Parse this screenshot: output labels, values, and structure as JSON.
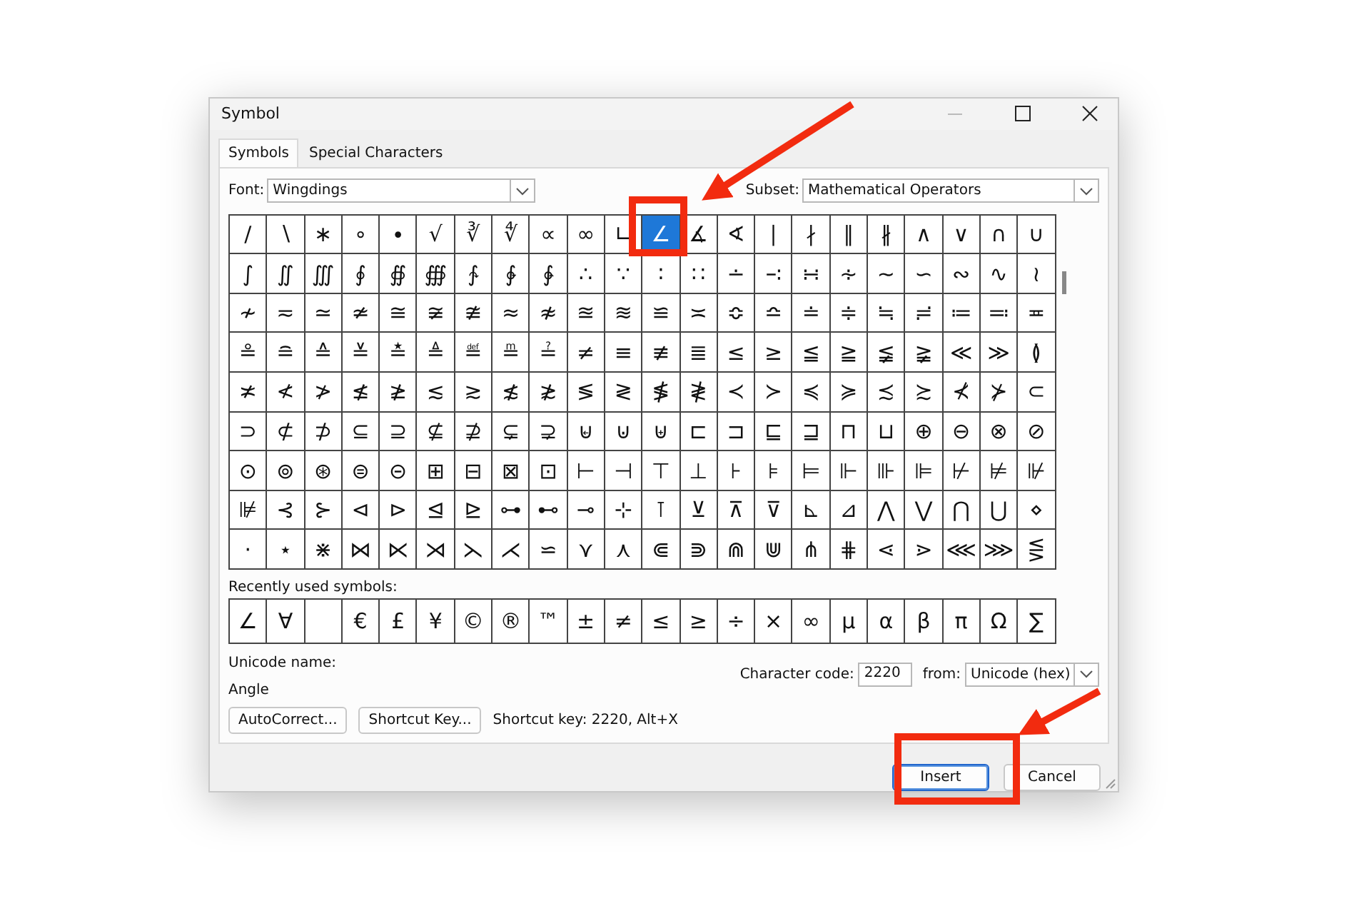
{
  "window": {
    "title": "Symbol"
  },
  "tabs": [
    {
      "label": "Symbols",
      "selected": true
    },
    {
      "label": "Special Characters",
      "selected": false
    }
  ],
  "font": {
    "label": "Font:",
    "value": "Wingdings"
  },
  "subset": {
    "label": "Subset:",
    "value": "Mathematical Operators"
  },
  "grid": [
    [
      {
        "s": "∕",
        "selected": false
      },
      {
        "s": "∖",
        "selected": false
      },
      {
        "s": "∗",
        "selected": false
      },
      {
        "s": "∘",
        "selected": false
      },
      {
        "s": "∙",
        "selected": false
      },
      {
        "s": "√",
        "selected": false
      },
      {
        "s": "∛",
        "selected": false
      },
      {
        "s": "∜",
        "selected": false
      },
      {
        "s": "∝",
        "selected": false
      },
      {
        "s": "∞",
        "selected": false
      },
      {
        "s": "∟",
        "selected": false
      },
      {
        "s": "∠",
        "selected": true
      },
      {
        "s": "∡",
        "selected": false
      },
      {
        "s": "∢",
        "selected": false
      },
      {
        "s": "∣",
        "selected": false
      },
      {
        "s": "∤",
        "selected": false
      },
      {
        "s": "∥",
        "selected": false
      },
      {
        "s": "∦",
        "selected": false
      },
      {
        "s": "∧",
        "selected": false
      },
      {
        "s": "∨",
        "selected": false
      },
      {
        "s": "∩",
        "selected": false
      },
      {
        "s": "∪",
        "selected": false
      }
    ],
    [
      "∫",
      "∬",
      "∭",
      "∮",
      "∯",
      "∰",
      "∱",
      "∲",
      "∳",
      "∴",
      "∵",
      "∶",
      "∷",
      "∸",
      "∹",
      "∺",
      "∻",
      "∼",
      "∽",
      "∾",
      "∿",
      "≀"
    ],
    [
      "≁",
      "≂",
      "≃",
      "≄",
      "≅",
      "≆",
      "≇",
      "≈",
      "≉",
      "≊",
      "≋",
      "≌",
      "≍",
      "≎",
      "≏",
      "≐",
      "≑",
      "≒",
      "≓",
      "≔",
      "≕",
      "≖"
    ],
    [
      "≗",
      "≘",
      "≙",
      "≚",
      "≛",
      "≜",
      "≝",
      "≞",
      "≟",
      "≠",
      "≡",
      "≢",
      "≣",
      "≤",
      "≥",
      "≦",
      "≧",
      "≨",
      "≩",
      "≪",
      "≫",
      "≬"
    ],
    [
      "≭",
      "≮",
      "≯",
      "≰",
      "≱",
      "≲",
      "≳",
      "≴",
      "≵",
      "≶",
      "≷",
      "≸",
      "≹",
      "≺",
      "≻",
      "≼",
      "≽",
      "≾",
      "≿",
      "⊀",
      "⊁",
      "⊂"
    ],
    [
      "⊃",
      "⊄",
      "⊅",
      "⊆",
      "⊇",
      "⊈",
      "⊉",
      "⊊",
      "⊋",
      "⊌",
      "⊍",
      "⊎",
      "⊏",
      "⊐",
      "⊑",
      "⊒",
      "⊓",
      "⊔",
      "⊕",
      "⊖",
      "⊗",
      "⊘"
    ],
    [
      "⊙",
      "⊚",
      "⊛",
      "⊜",
      "⊝",
      "⊞",
      "⊟",
      "⊠",
      "⊡",
      "⊢",
      "⊣",
      "⊤",
      "⊥",
      "⊦",
      "⊧",
      "⊨",
      "⊩",
      "⊪",
      "⊫",
      "⊬",
      "⊭",
      "⊮"
    ],
    [
      "⊯",
      "⊰",
      "⊱",
      "⊲",
      "⊳",
      "⊴",
      "⊵",
      "⊶",
      "⊷",
      "⊸",
      "⊹",
      "⊺",
      "⊻",
      "⊼",
      "⊽",
      "⊾",
      "⊿",
      "⋀",
      "⋁",
      "⋂",
      "⋃",
      "⋄"
    ],
    [
      "⋅",
      "⋆",
      "⋇",
      "⋈",
      "⋉",
      "⋊",
      "⋋",
      "⋌",
      "⋍",
      "⋎",
      "⋏",
      "⋐",
      "⋑",
      "⋒",
      "⋓",
      "⋔",
      "⋕",
      "⋖",
      "⋗",
      "⋘",
      "⋙",
      "⋚"
    ]
  ],
  "recent": {
    "label": "Recently used symbols:",
    "items": [
      {
        "kind": "symbol",
        "text": "∠"
      },
      {
        "kind": "symbol",
        "text": "∀"
      },
      {
        "kind": "blank"
      },
      {
        "kind": "symbol",
        "text": "€"
      },
      {
        "kind": "symbol",
        "text": "£"
      },
      {
        "kind": "symbol",
        "text": "¥"
      },
      {
        "kind": "symbol",
        "text": "©"
      },
      {
        "kind": "symbol",
        "text": "®"
      },
      {
        "kind": "symbol",
        "text": "™"
      },
      {
        "kind": "symbol",
        "text": "±"
      },
      {
        "kind": "symbol",
        "text": "≠"
      },
      {
        "kind": "symbol",
        "text": "≤"
      },
      {
        "kind": "symbol",
        "text": "≥"
      },
      {
        "kind": "symbol",
        "text": "÷"
      },
      {
        "kind": "symbol",
        "text": "×"
      },
      {
        "kind": "symbol",
        "text": "∞"
      },
      {
        "kind": "symbol",
        "text": "µ"
      },
      {
        "kind": "symbol",
        "text": "α"
      },
      {
        "kind": "symbol",
        "text": "β"
      },
      {
        "kind": "symbol",
        "text": "π"
      },
      {
        "kind": "symbol",
        "text": "Ω"
      },
      {
        "kind": "symbol",
        "text": "∑"
      }
    ]
  },
  "unicode_name": {
    "label": "Unicode name:",
    "value": "Angle"
  },
  "character_code": {
    "label": "Character code:",
    "value": "2220"
  },
  "from": {
    "label": "from:",
    "value": "Unicode (hex)"
  },
  "buttons": [
    {
      "label": "AutoCorrect..."
    },
    {
      "label": "Shortcut Key..."
    }
  ],
  "shortcut_text": "Shortcut key: 2220, Alt+X",
  "footer_buttons": [
    {
      "label": "Insert",
      "default": true
    },
    {
      "label": "Cancel",
      "default": false
    }
  ],
  "callouts": [
    {
      "kind": "arrow"
    },
    {
      "kind": "box"
    },
    {
      "kind": "arrow"
    },
    {
      "kind": "box"
    }
  ]
}
